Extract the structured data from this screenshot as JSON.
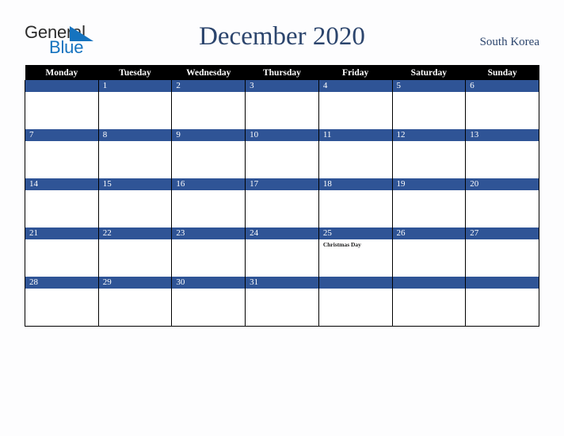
{
  "brand": {
    "name_part1": "General",
    "name_part2": "Blue",
    "triangle_icon": "triangle-icon",
    "color_dark": "#2b2b2b",
    "color_blue": "#1573bf"
  },
  "header": {
    "title": "December 2020",
    "country": "South Korea",
    "title_color": "#2c456d"
  },
  "calendar": {
    "month": "December",
    "year": "2020",
    "weekday_headers": [
      "Monday",
      "Tuesday",
      "Wednesday",
      "Thursday",
      "Friday",
      "Saturday",
      "Sunday"
    ],
    "header_bg": "#000000",
    "header_text_color": "#ffffff",
    "date_band_bg": "#2f5496",
    "date_text_color": "#ffffff",
    "cell_bg": "#ffffff",
    "weeks": [
      {
        "days": [
          {
            "number": "",
            "events": []
          },
          {
            "number": "1",
            "events": []
          },
          {
            "number": "2",
            "events": []
          },
          {
            "number": "3",
            "events": []
          },
          {
            "number": "4",
            "events": []
          },
          {
            "number": "5",
            "events": []
          },
          {
            "number": "6",
            "events": []
          }
        ]
      },
      {
        "days": [
          {
            "number": "7",
            "events": []
          },
          {
            "number": "8",
            "events": []
          },
          {
            "number": "9",
            "events": []
          },
          {
            "number": "10",
            "events": []
          },
          {
            "number": "11",
            "events": []
          },
          {
            "number": "12",
            "events": []
          },
          {
            "number": "13",
            "events": []
          }
        ]
      },
      {
        "days": [
          {
            "number": "14",
            "events": []
          },
          {
            "number": "15",
            "events": []
          },
          {
            "number": "16",
            "events": []
          },
          {
            "number": "17",
            "events": []
          },
          {
            "number": "18",
            "events": []
          },
          {
            "number": "19",
            "events": []
          },
          {
            "number": "20",
            "events": []
          }
        ]
      },
      {
        "days": [
          {
            "number": "21",
            "events": []
          },
          {
            "number": "22",
            "events": []
          },
          {
            "number": "23",
            "events": []
          },
          {
            "number": "24",
            "events": []
          },
          {
            "number": "25",
            "events": [
              "Christmas Day"
            ]
          },
          {
            "number": "26",
            "events": []
          },
          {
            "number": "27",
            "events": []
          }
        ]
      },
      {
        "days": [
          {
            "number": "28",
            "events": []
          },
          {
            "number": "29",
            "events": []
          },
          {
            "number": "30",
            "events": []
          },
          {
            "number": "31",
            "events": []
          },
          {
            "number": "",
            "events": []
          },
          {
            "number": "",
            "events": []
          },
          {
            "number": "",
            "events": []
          }
        ]
      }
    ]
  }
}
